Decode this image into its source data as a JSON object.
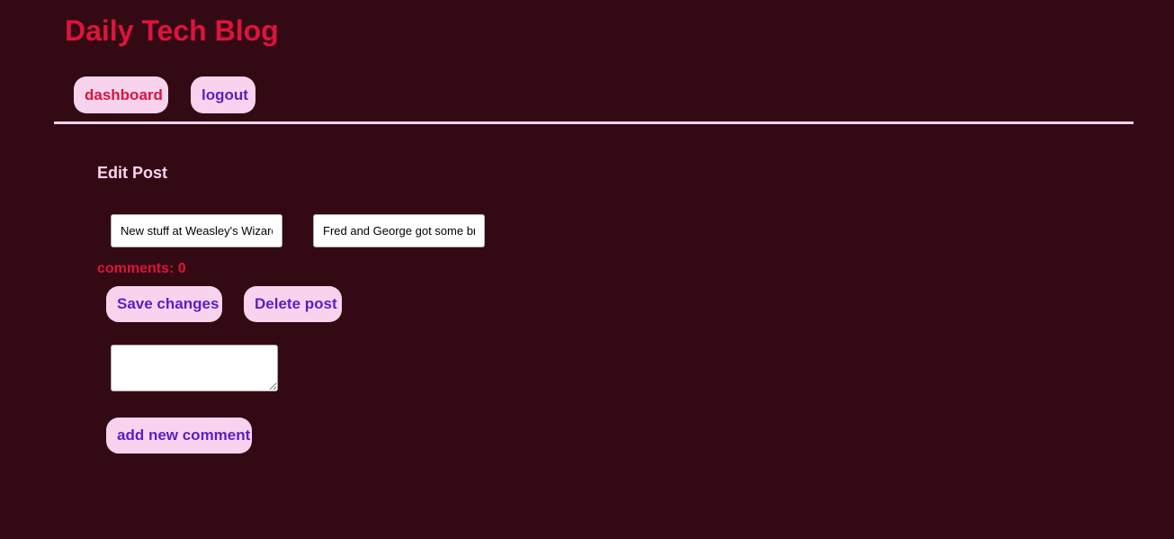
{
  "header": {
    "site_title": "Daily Tech Blog",
    "nav": {
      "dashboard_label": "dashboard",
      "logout_label": "logout"
    }
  },
  "edit_post": {
    "heading": "Edit Post",
    "title_value": "New stuff at Weasley's Wizard Wheezes",
    "content_value": "Fred and George got some brand new products",
    "comments_label": "comments: 0",
    "save_label": "Save changes",
    "delete_label": "Delete post",
    "comment_value": "",
    "add_comment_label": "add new comment"
  },
  "colors": {
    "background": "#330914",
    "accent_red": "#dc143c",
    "accent_purple": "#5b1ec5",
    "pill_pink": "#f8d3ee"
  }
}
